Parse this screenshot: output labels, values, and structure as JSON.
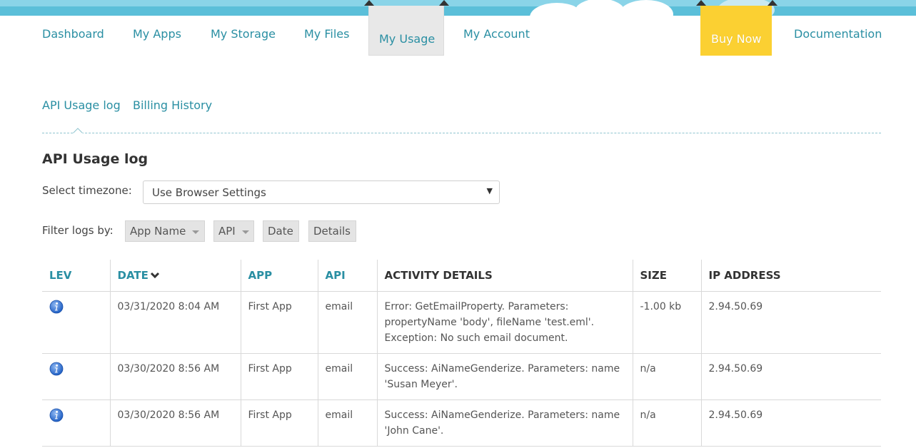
{
  "colors": {
    "link": "#2a8fa3",
    "buy_bg": "#fbd032",
    "active_tab_bg": "#e8e8e8",
    "sky": "#5bbfd9",
    "info_icon": "#2f6fd0"
  },
  "nav": {
    "items": [
      {
        "label": "Dashboard"
      },
      {
        "label": "My Apps"
      },
      {
        "label": "My Storage"
      },
      {
        "label": "My Files"
      },
      {
        "label": "My Usage"
      },
      {
        "label": "My Account"
      }
    ],
    "buy_now": "Buy Now",
    "documentation": "Documentation",
    "active": "My Usage"
  },
  "subnav": {
    "items": [
      {
        "label": "API Usage log"
      },
      {
        "label": "Billing History"
      }
    ],
    "active": "API Usage log"
  },
  "page": {
    "title": "API Usage log"
  },
  "timezone": {
    "label": "Select timezone:",
    "value": "Use Browser Settings"
  },
  "filters": {
    "label": "Filter logs by:",
    "buttons": [
      {
        "label": "App Name",
        "dropdown": true
      },
      {
        "label": "API",
        "dropdown": true
      },
      {
        "label": "Date",
        "dropdown": false
      },
      {
        "label": "Details",
        "dropdown": false
      }
    ]
  },
  "table": {
    "columns": [
      "LEV",
      "DATE",
      "APP",
      "API",
      "ACTIVITY DETAILS",
      "SIZE",
      "IP ADDRESS"
    ],
    "sorted_by": "DATE",
    "rows": [
      {
        "level_icon": "info-icon",
        "date": "03/31/2020 8:04 AM",
        "app": "First App",
        "api": "email",
        "details": "Error: GetEmailProperty. Parameters: propertyName 'body', fileName 'test.eml'. Exception: No such email document.",
        "size": "-1.00 kb",
        "ip": "2.94.50.69"
      },
      {
        "level_icon": "info-icon",
        "date": "03/30/2020 8:56 AM",
        "app": "First App",
        "api": "email",
        "details": "Success: AiNameGenderize. Parameters: name 'Susan Meyer'.",
        "size": "n/a",
        "ip": "2.94.50.69"
      },
      {
        "level_icon": "info-icon",
        "date": "03/30/2020 8:56 AM",
        "app": "First App",
        "api": "email",
        "details": "Success: AiNameGenderize. Parameters: name 'John Cane'.",
        "size": "n/a",
        "ip": "2.94.50.69"
      }
    ]
  }
}
